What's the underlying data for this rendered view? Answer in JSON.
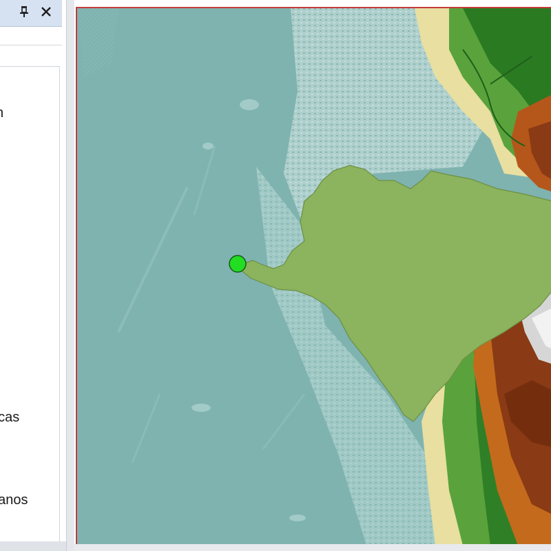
{
  "toc": {
    "partial_labels": [
      "ricas",
      "panos"
    ],
    "fragment_top": "n",
    "pin_glyph": "📌",
    "close_glyph": "✕",
    "icons": [
      "pin-icon",
      "close-icon"
    ]
  },
  "map": {
    "layers_visible": [
      "ocean",
      "bathymetry",
      "terrain-hillshade",
      "watershed-polygon",
      "outlet-point"
    ],
    "colors": {
      "ocean": "#7fb3b0",
      "shelf": "#a9cfcc",
      "watershed": "#8cb35d",
      "lowland": "#e8dfa0",
      "green": "#3d8c2e",
      "dark_green": "#2a6b1e",
      "brown": "#8a3a14",
      "orange": "#c46a1c",
      "peak": "#d8d8d8",
      "outlet": "#22dd22",
      "frame": "#c43b3b"
    }
  }
}
